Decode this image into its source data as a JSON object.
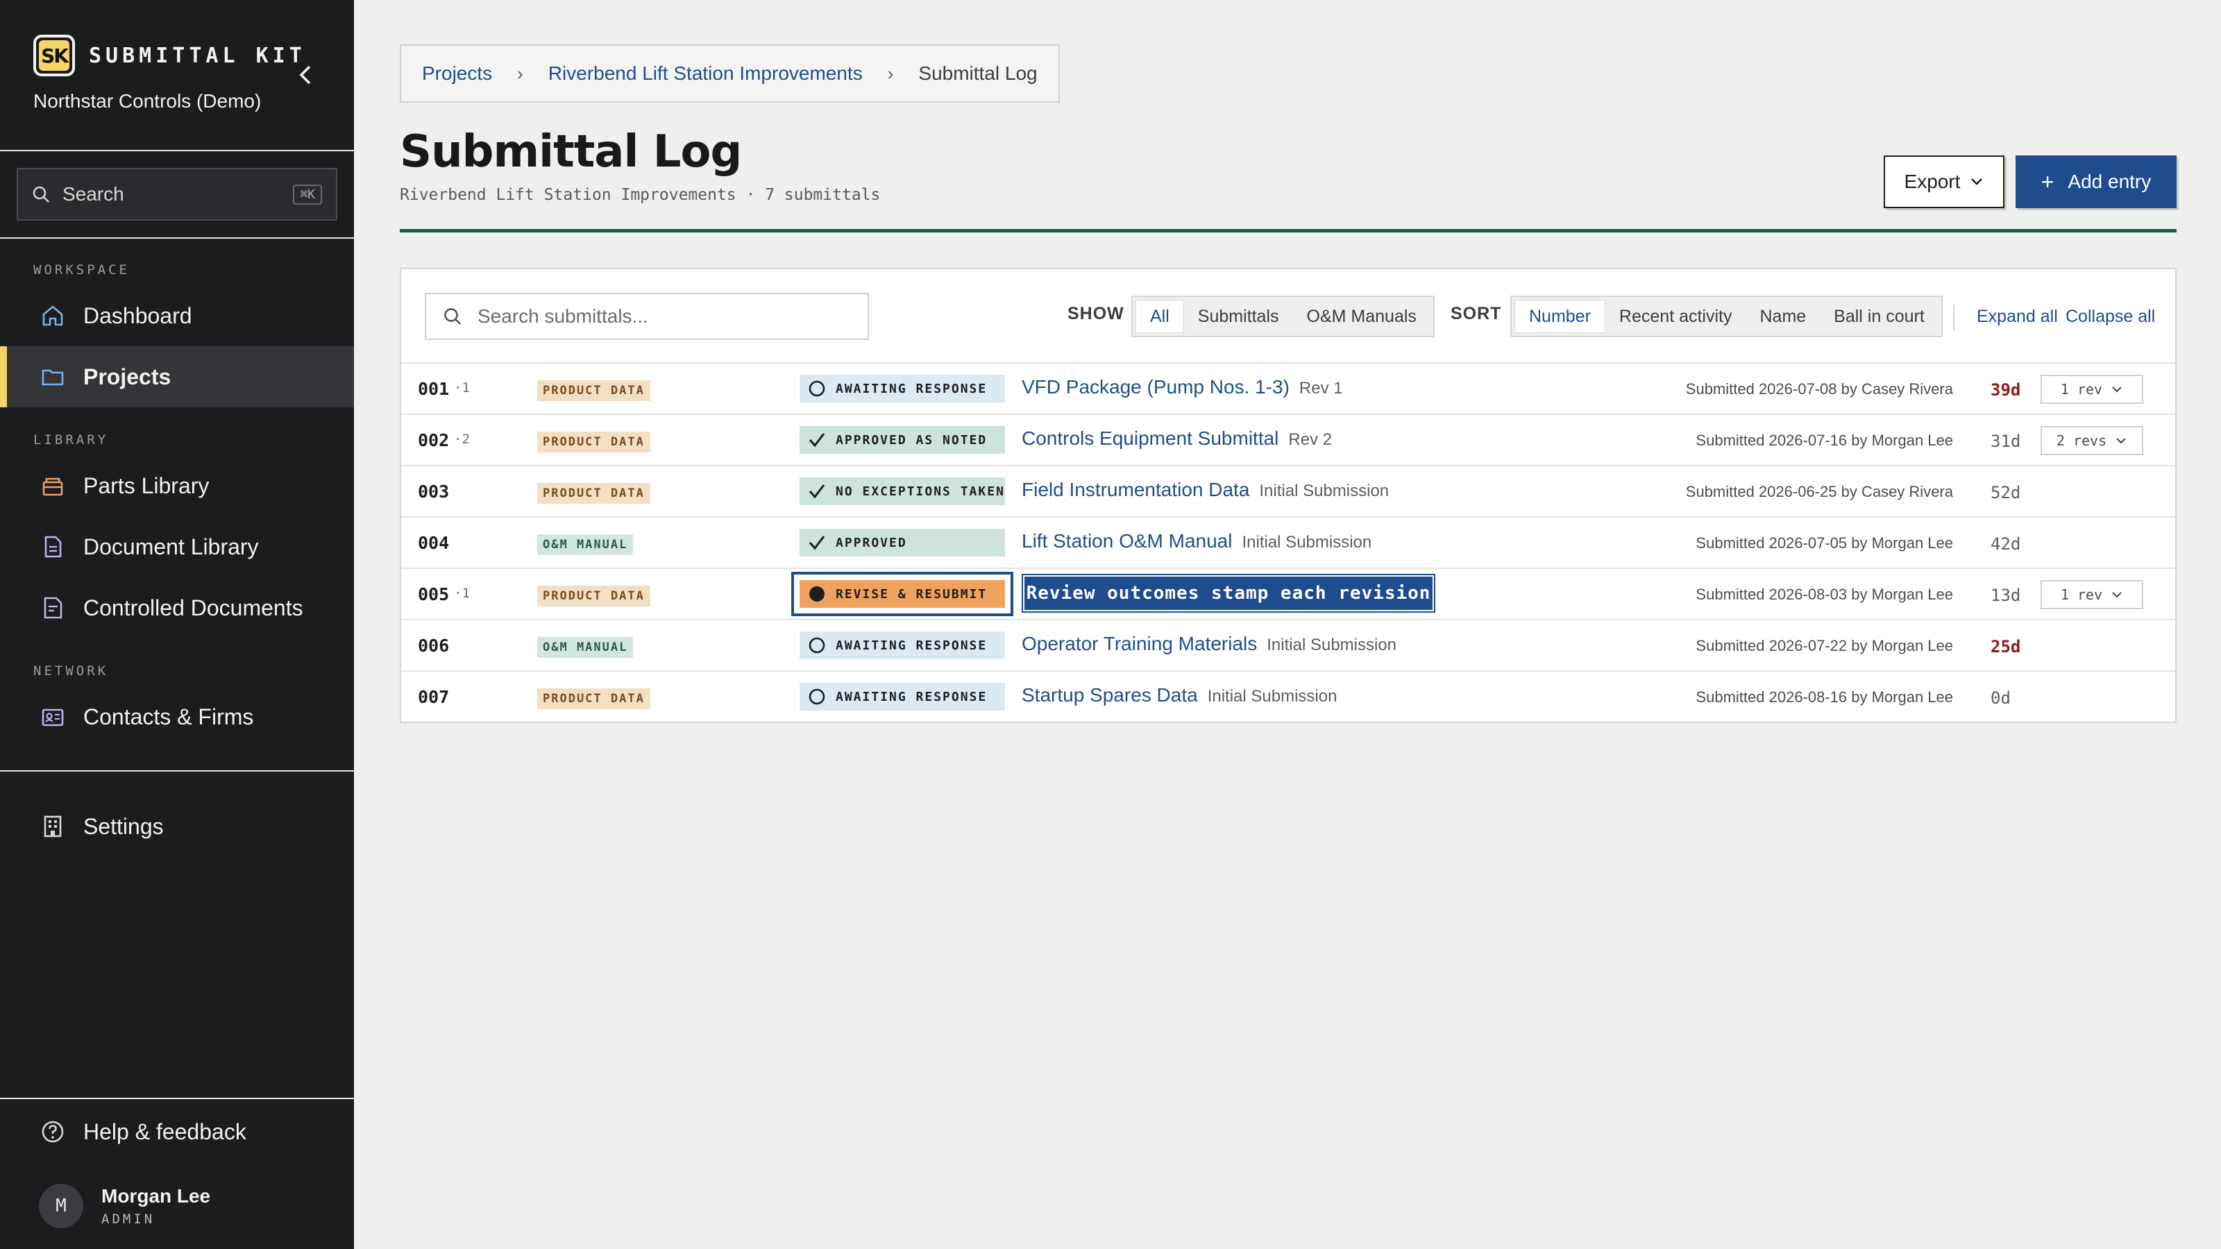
{
  "sidebar": {
    "brand": "SUBMITTAL KIT",
    "logo_text": "SK",
    "org": "Northstar Controls (Demo)",
    "search_label": "Search",
    "search_shortcut": "⌘K",
    "sections": {
      "workspace": "WORKSPACE",
      "library": "LIBRARY",
      "network": "NETWORK"
    },
    "items": [
      {
        "label": "Dashboard",
        "icon": "home-icon"
      },
      {
        "label": "Projects",
        "icon": "folder-icon",
        "active": true
      },
      {
        "label": "Parts Library",
        "icon": "box-icon"
      },
      {
        "label": "Document Library",
        "icon": "document-icon"
      },
      {
        "label": "Controlled Documents",
        "icon": "controlled-document-icon"
      },
      {
        "label": "Contacts & Firms",
        "icon": "contact-card-icon"
      },
      {
        "label": "Settings",
        "icon": "building-icon"
      },
      {
        "label": "Help & feedback",
        "icon": "help-icon"
      }
    ],
    "user": {
      "initial": "M",
      "name": "Morgan Lee",
      "role": "ADMIN"
    }
  },
  "breadcrumb": [
    "Projects",
    "Riverbend Lift Station Improvements",
    "Submittal Log"
  ],
  "header": {
    "title": "Submittal Log",
    "subtitle": "Riverbend Lift Station Improvements · 7 submittals",
    "export_label": "Export",
    "add_label": "Add entry"
  },
  "toolbar": {
    "search_placeholder": "Search submittals...",
    "show_label": "SHOW",
    "show_options": [
      "All",
      "Submittals",
      "O&M Manuals"
    ],
    "sort_label": "SORT",
    "sort_options": [
      "Number",
      "Recent activity",
      "Name",
      "Ball in court"
    ],
    "expand_all": "Expand all",
    "collapse_all": "Collapse all"
  },
  "rows": [
    {
      "num": "001",
      "rev": "·1",
      "type": "PRODUCT DATA",
      "status": "AWAITING RESPONSE",
      "title": "VFD Package (Pump Nos. 1-3)",
      "rev_label": "Rev 1",
      "meta": "Submitted 2026-07-08 by Casey Rivera",
      "age": "39d",
      "revs": "1 rev"
    },
    {
      "num": "002",
      "rev": "·2",
      "type": "PRODUCT DATA",
      "status": "APPROVED AS NOTED",
      "title": "Controls Equipment Submittal",
      "rev_label": "Rev 2",
      "meta": "Submitted 2026-07-16 by Morgan Lee",
      "age": "31d",
      "revs": "2 revs"
    },
    {
      "num": "003",
      "rev": "",
      "type": "PRODUCT DATA",
      "status": "NO EXCEPTIONS TAKEN",
      "title": "Field Instrumentation Data",
      "rev_label": "Initial Submission",
      "meta": "Submitted 2026-06-25 by Casey Rivera",
      "age": "52d",
      "revs": ""
    },
    {
      "num": "004",
      "rev": "",
      "type": "O&M MANUAL",
      "status": "APPROVED",
      "title": "Lift Station O&M Manual",
      "rev_label": "Initial Submission",
      "meta": "Submitted 2026-07-05 by Morgan Lee",
      "age": "42d",
      "revs": ""
    },
    {
      "num": "005",
      "rev": "·1",
      "type": "PRODUCT DATA",
      "status": "REVISE & RESUBMIT",
      "title": "",
      "rev_label": "",
      "meta": "Submitted 2026-08-03 by Morgan Lee",
      "age": "13d",
      "revs": "1 rev"
    },
    {
      "num": "006",
      "rev": "",
      "type": "O&M MANUAL",
      "status": "AWAITING RESPONSE",
      "title": "Operator Training Materials",
      "rev_label": "Initial Submission",
      "meta": "Submitted 2026-07-22 by Morgan Lee",
      "age": "25d",
      "revs": ""
    },
    {
      "num": "007",
      "rev": "",
      "type": "PRODUCT DATA",
      "status": "AWAITING RESPONSE",
      "title": "Startup Spares Data",
      "rev_label": "Initial Submission",
      "meta": "Submitted 2026-08-16 by Morgan Lee",
      "age": "0d",
      "revs": ""
    }
  ],
  "tooltip": "Review outcomes stamp each revision",
  "colors": {
    "accent": "#1e4c8e",
    "brand_yellow": "#f4d56a",
    "overdue": "#8a1c1c",
    "rule": "#1f5a4f"
  }
}
